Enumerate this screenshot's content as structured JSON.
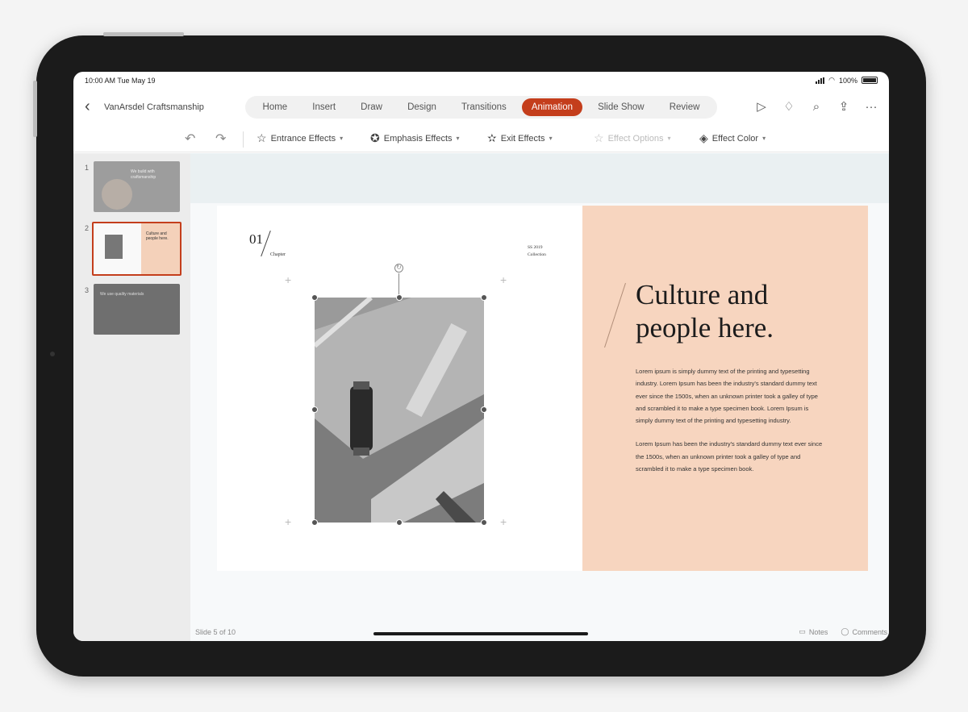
{
  "status": {
    "time": "10:00 AM  Tue May 19",
    "battery": "100%"
  },
  "titlebar": {
    "doc_title": "VanArsdel Craftsmanship",
    "tabs": [
      "Home",
      "Insert",
      "Draw",
      "Design",
      "Transitions",
      "Animation",
      "Slide Show",
      "Review"
    ],
    "active_tab": "Animation"
  },
  "ribbon": {
    "entrance": "Entrance Effects",
    "emphasis": "Emphasis Effects",
    "exit": "Exit Effects",
    "options": "Effect Options",
    "color": "Effect Color"
  },
  "thumbnails": {
    "numbers": [
      "1",
      "2",
      "3"
    ],
    "t1_text": "We build with craftsmanship",
    "t2_text": "Culture and people here.",
    "t3_text": "We use quality materials"
  },
  "slide": {
    "number": "01",
    "chapter": "Chapter",
    "meta_line1": "SS 2019",
    "meta_line2": "Collection",
    "headline": "Culture and people here.",
    "paragraph1": "Lorem ipsum is simply dummy text of the printing and typesetting industry. Lorem Ipsum has been the industry's standard dummy text ever since the 1500s, when an unknown printer took a galley of type and scrambled it to make a type specimen book. Lorem Ipsum is simply dummy text of the printing and typesetting industry.",
    "paragraph2": "Lorem Ipsum has been the industry's standard dummy text ever since the 1500s, when an unknown printer took a galley of type and scrambled it to make a type specimen book."
  },
  "bottombar": {
    "slide_indicator": "Slide 5 of 10",
    "notes": "Notes",
    "comments": "Comments"
  },
  "colors": {
    "accent": "#c43e1c",
    "slide_panel": "#f7d5bf"
  }
}
